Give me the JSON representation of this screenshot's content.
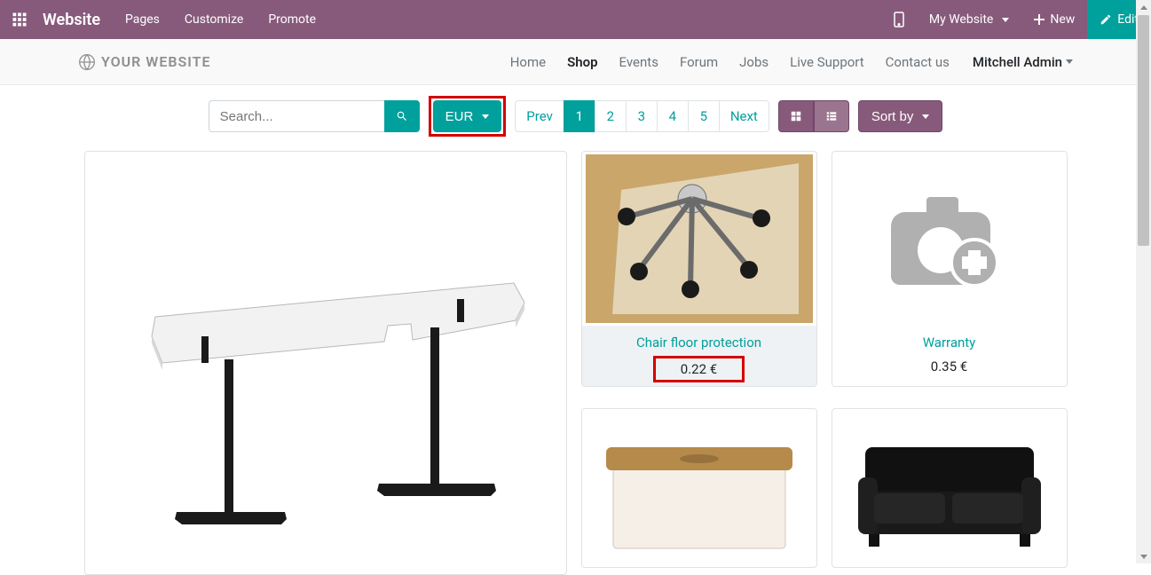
{
  "topbar": {
    "brand": "Website",
    "nav": [
      "Pages",
      "Customize",
      "Promote"
    ],
    "my_website": "My Website",
    "new_label": "New",
    "edit_label": "Edit"
  },
  "siteheader": {
    "logo_text": "YOUR WEBSITE",
    "nav": [
      "Home",
      "Shop",
      "Events",
      "Forum",
      "Jobs",
      "Live Support",
      "Contact us"
    ],
    "active_nav": "Shop",
    "user": "Mitchell Admin"
  },
  "toolbar": {
    "search_placeholder": "Search...",
    "currency": "EUR",
    "pager": [
      "Prev",
      "1",
      "2",
      "3",
      "4",
      "5",
      "Next"
    ],
    "pager_active": "1",
    "sort_label": "Sort by"
  },
  "products": {
    "chair_protection": {
      "title": "Chair floor protection",
      "price": "0.22 €"
    },
    "warranty": {
      "title": "Warranty",
      "price": "0.35 €"
    }
  }
}
